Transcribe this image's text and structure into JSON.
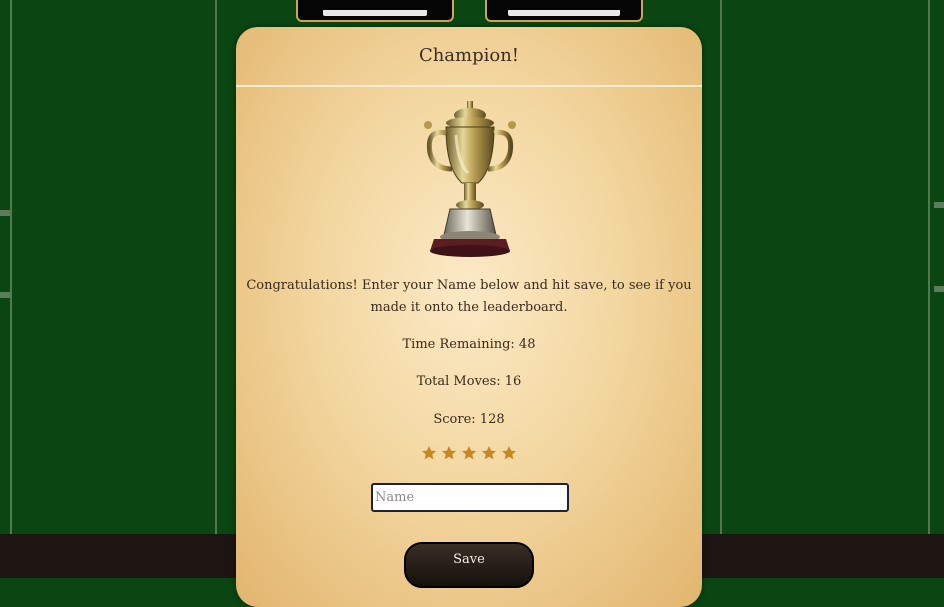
{
  "background": {
    "field_color": "#0a4512",
    "bottom_bar_color": "#1c1512"
  },
  "modal": {
    "title": "Champion!",
    "trophy_icon": "trophy-icon",
    "message": "Congratulations! Enter your Name below and hit save, to see if you made it onto the leaderboard.",
    "time_remaining_label": "Time Remaining: 48",
    "total_moves_label": "Total Moves: 16",
    "score_label": "Score: 128",
    "rating": {
      "stars": 5,
      "max": 5,
      "color": "#c8871e"
    },
    "name_input": {
      "placeholder": "Name",
      "value": ""
    },
    "save_label": "Save"
  }
}
